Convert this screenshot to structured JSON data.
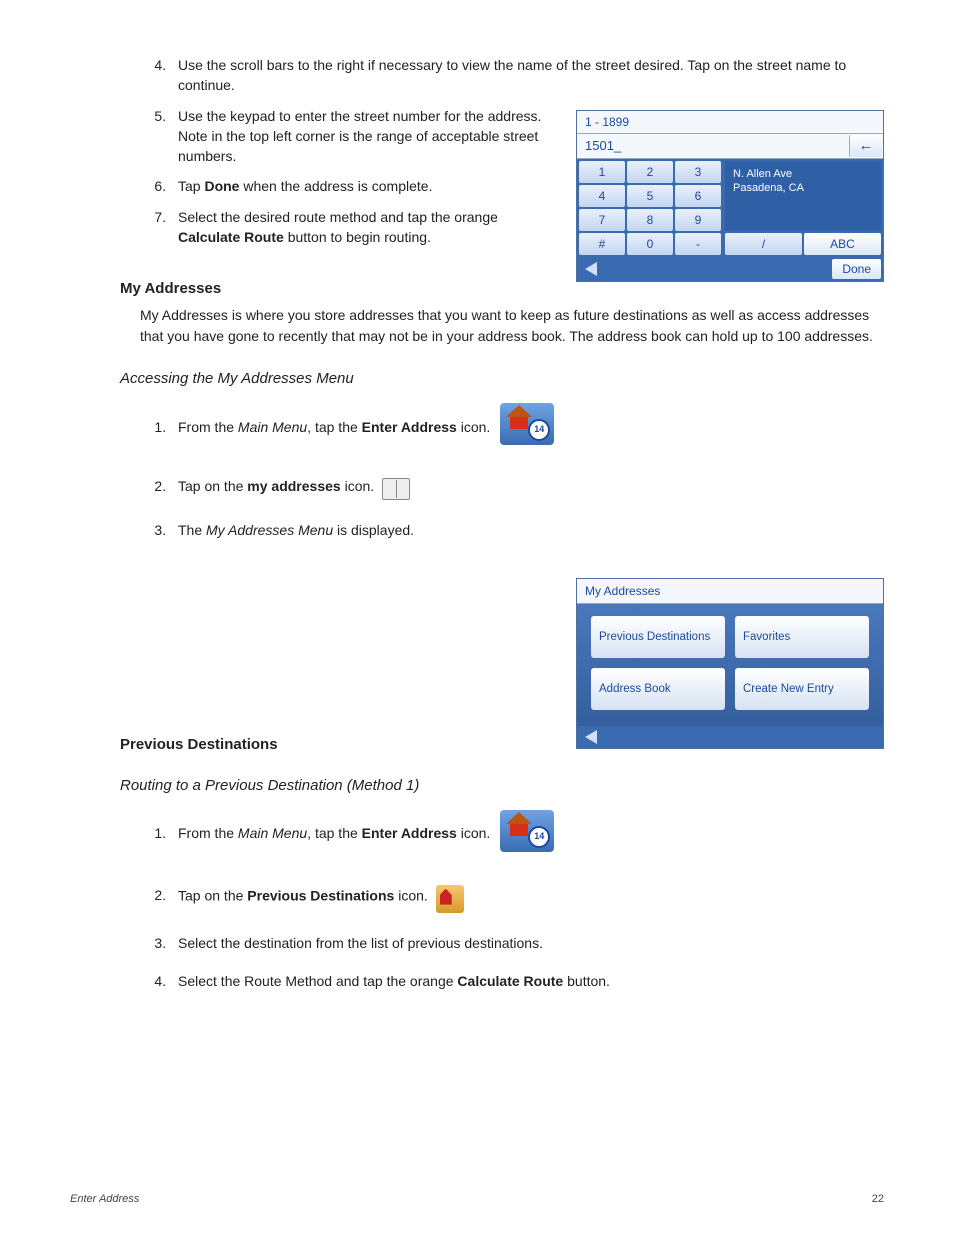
{
  "steps_top": {
    "start": 4,
    "items": [
      {
        "n": "4",
        "text": "Use the scroll bars to the right if necessary to view the name of the street desired.  Tap on the street name to continue."
      },
      {
        "n": "5",
        "text": "Use the keypad to enter the street number for the address.  Note in the top left corner is the range of acceptable street numbers.",
        "narrow": true
      },
      {
        "n": "6",
        "pre": "Tap ",
        "bold": "Done",
        "post": " when the address is complete.",
        "narrow": true
      },
      {
        "n": "7",
        "pre": "Select the desired route method and tap the orange ",
        "bold": "Calculate Route",
        "post": " button to begin routing.",
        "narrow": true
      }
    ]
  },
  "keypad": {
    "range": "1 - 1899",
    "input": "1501_",
    "keys": [
      "1",
      "2",
      "3",
      "4",
      "5",
      "6",
      "7",
      "8",
      "9",
      "#",
      "0",
      "-"
    ],
    "suggest_line1": "N. Allen Ave",
    "suggest_line2": "Pasadena, CA",
    "slash": "/",
    "abc": "ABC",
    "done": "Done"
  },
  "myaddr_heading": "My Addresses",
  "myaddr_para": "My Addresses is where you store addresses that you want to keep as future destinations as well as access addresses that you have gone to recently that may not be in your address book.  The address book can hold up to 100 addresses.",
  "sub_accessing": "Accessing the My Addresses Menu",
  "access_steps": {
    "s1_pre": "From the ",
    "s1_it": "Main Menu",
    "s1_mid": ", tap the ",
    "s1_bold": "Enter Address",
    "s1_post": " icon.",
    "s2_pre": "Tap on the ",
    "s2_bold": "my addresses",
    "s2_post": " icon.",
    "s3_pre": "The ",
    "s3_it": "My Addresses Menu",
    "s3_post": " is displayed."
  },
  "myaddr_panel": {
    "title": "My Addresses",
    "buttons": [
      "Previous Destinations",
      "Favorites",
      "Address Book",
      "Create New Entry"
    ]
  },
  "prev_heading": "Previous Destinations",
  "sub_routing": "Routing to a Previous Destination (Method 1)",
  "prev_steps": {
    "s1_pre": "From the ",
    "s1_it": "Main Menu",
    "s1_mid": ", tap the ",
    "s1_bold": "Enter Address",
    "s1_post": " icon.",
    "s2_pre": "Tap on the ",
    "s2_bold": "Previous Destinations",
    "s2_post": " icon.",
    "s3": "Select the destination from the list of previous destinations.",
    "s4_pre": "Select the Route Method and tap the orange ",
    "s4_bold": "Calculate Route",
    "s4_post": " button."
  },
  "footer": {
    "left": "Enter Address",
    "right": "22"
  },
  "ea_badge": "14"
}
